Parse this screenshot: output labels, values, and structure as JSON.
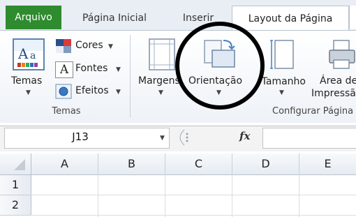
{
  "tabs": {
    "file": "Arquivo",
    "home": "Página Inicial",
    "insert": "Inserir",
    "page_layout": "Layout da Página"
  },
  "themes_group": {
    "themes_label": "Temas",
    "colors_label": "Cores",
    "fonts_label": "Fontes",
    "effects_label": "Efeitos",
    "group_label": "Temas"
  },
  "page_setup_group": {
    "margins_label": "Margens",
    "orientation_label": "Orientação",
    "size_label": "Tamanho",
    "print_area_label_1": "Área de",
    "print_area_label_2": "Impressão",
    "group_label": "Configurar Página"
  },
  "formula_bar": {
    "name_box_value": "J13",
    "fx_symbol": "fx",
    "formula_value": ""
  },
  "grid": {
    "columns": [
      "A",
      "B",
      "C",
      "D",
      "E"
    ],
    "rows": [
      "1",
      "2"
    ]
  },
  "colors": {
    "file_tab": "#2e8b2e",
    "highlight_circle": "#000000"
  }
}
